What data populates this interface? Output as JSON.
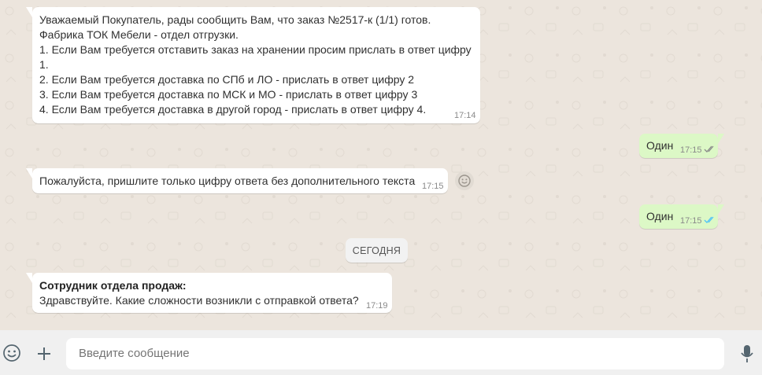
{
  "messages": {
    "m1": {
      "lines": [
        "Уважаемый Покупатель, рады сообщить Вам, что заказ №2517-к (1/1) готов.",
        "Фабрика ТОК Мебели - отдел отгрузки.",
        "1. Если Вам требуется отставить заказ на хранении просим прислать в ответ цифру",
        "1.",
        "2. Если Вам требуется доставка по СПб и ЛО - прислать в ответ цифру 2",
        "3. Если Вам требуется доставка по МСК и МО - прислать в ответ цифру 3",
        "4. Если Вам требуется доставка в другой город - прислать в ответ цифру 4."
      ],
      "time": "17:14"
    },
    "m2": {
      "text": "Один",
      "time": "17:15"
    },
    "m3": {
      "text": "Пожалуйста, пришлите только цифру ответа без дополнительного текста",
      "time": "17:15"
    },
    "m4": {
      "text": "Один",
      "time": "17:15"
    },
    "m5": {
      "sender": "Сотрудник отдела продаж:",
      "text": "Здравствуйте. Какие сложности возникли с отправкой ответа?",
      "time": "17:19"
    }
  },
  "date_divider": "СЕГОДНЯ",
  "composer": {
    "placeholder": "Введите сообщение",
    "icons": [
      "emoji-icon",
      "plus-icon",
      "microphone-icon"
    ]
  },
  "colors": {
    "chat_bg": "#ece5dd",
    "incoming": "#ffffff",
    "outgoing": "#dcf8c6",
    "read_ticks": "#4fc3f7"
  }
}
